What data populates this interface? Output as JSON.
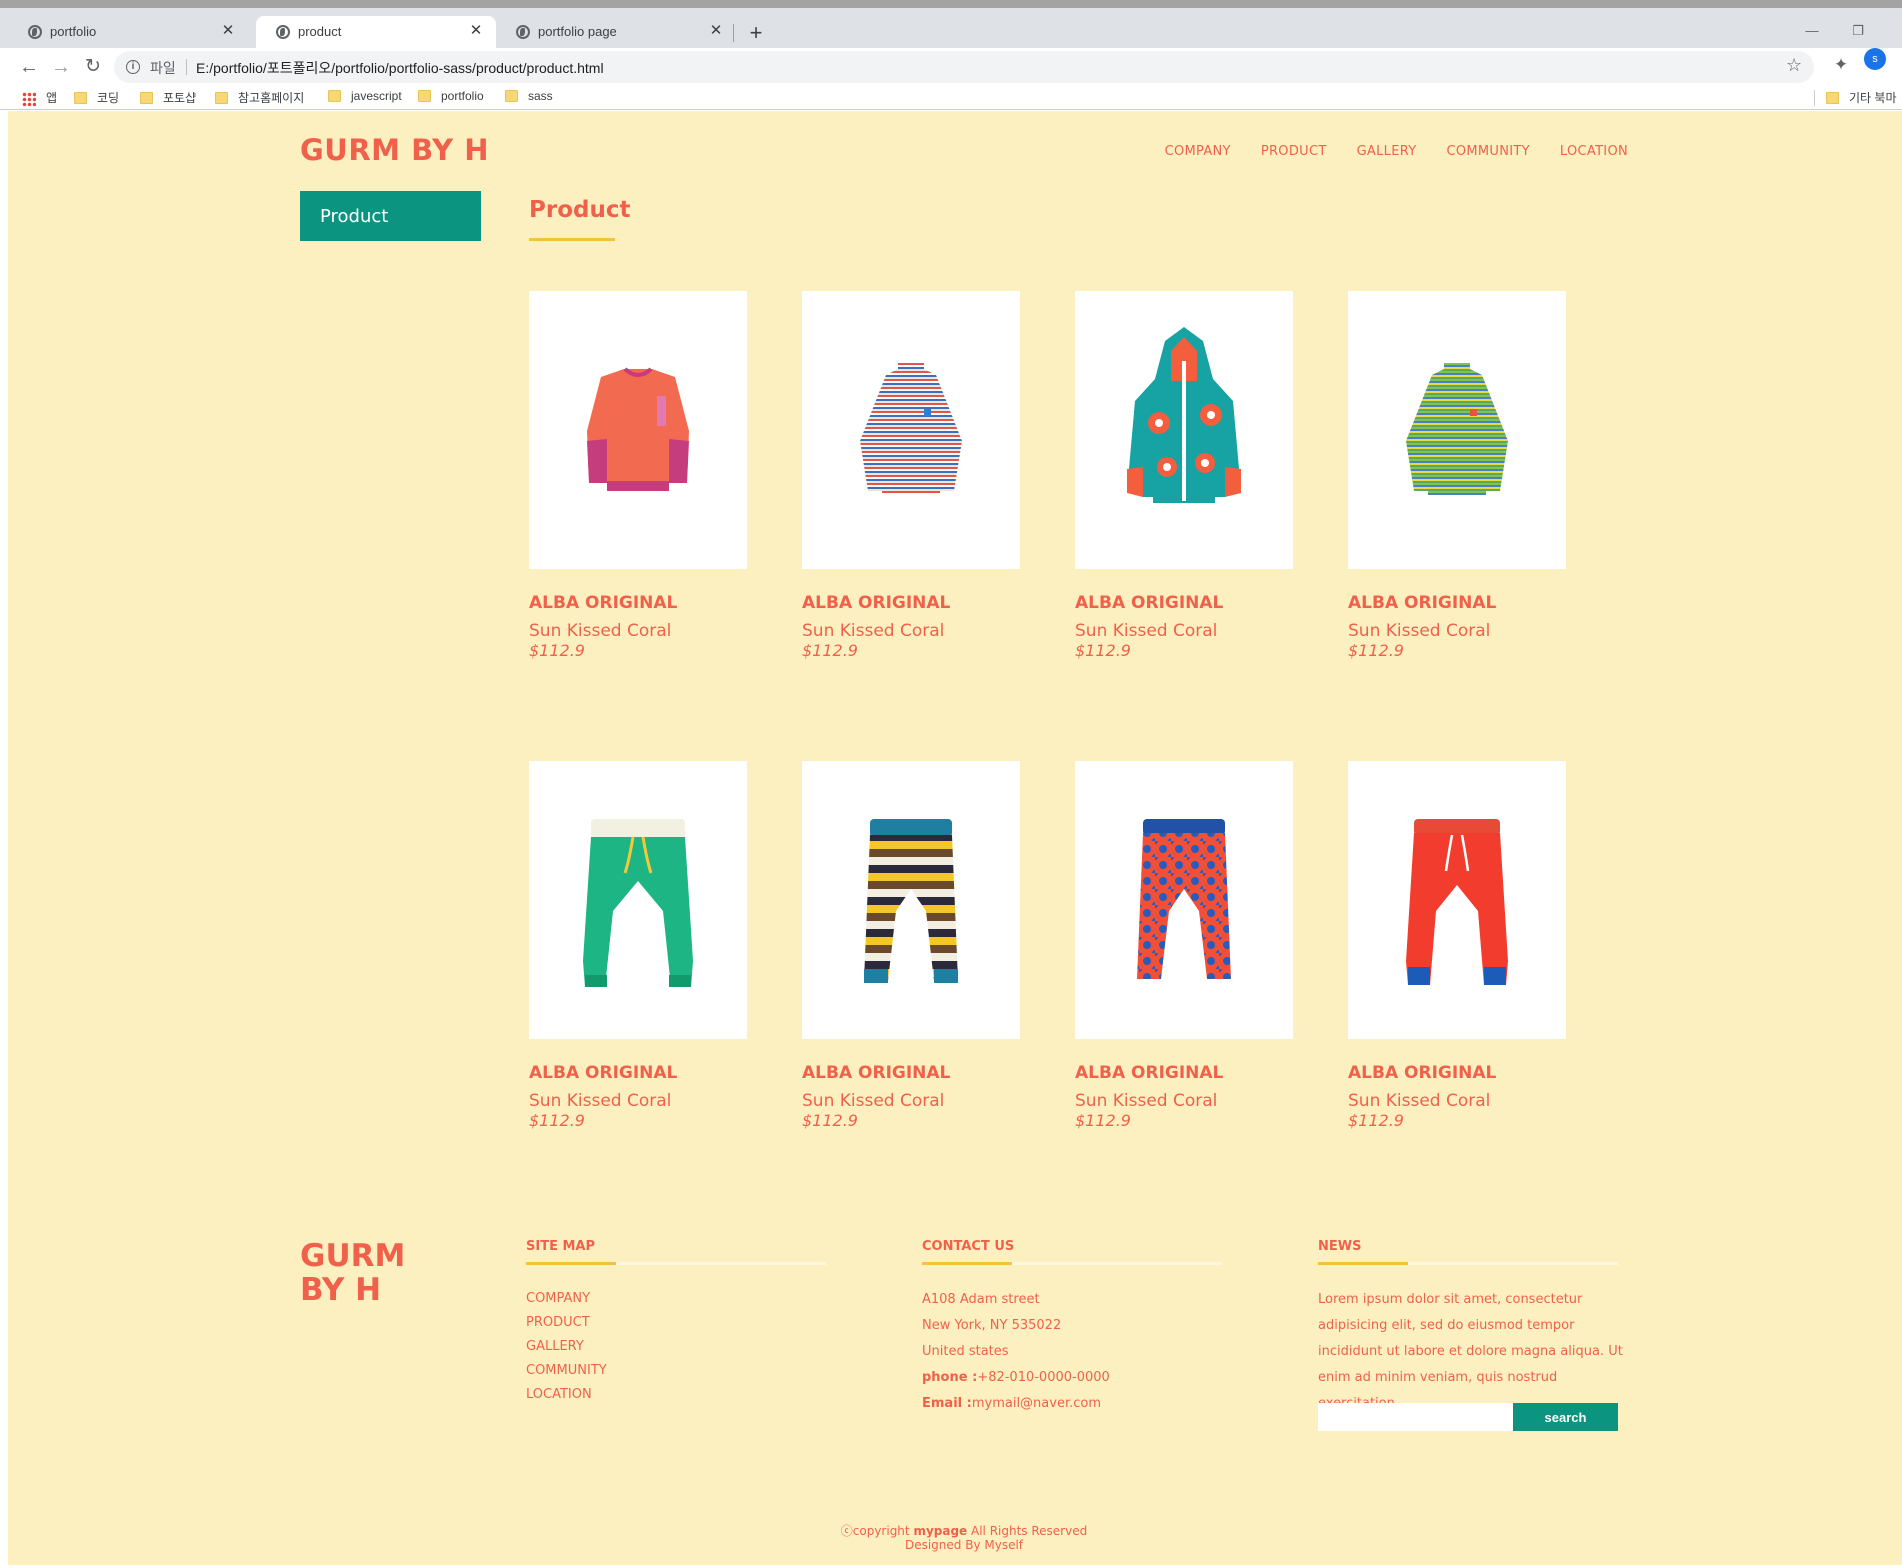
{
  "browser": {
    "tabs": [
      {
        "title": "portfolio",
        "active": false
      },
      {
        "title": "product",
        "active": true
      },
      {
        "title": "portfolio page",
        "active": false
      }
    ],
    "new_tab_label": "+",
    "scheme_label": "파일",
    "url": "E:/portfolio/포트폴리오/portfolio/portfolio-sass/product/product.html",
    "profile_initial": "s",
    "bookmarks": [
      "앱",
      "코딩",
      "포토샵",
      "참고홈페이지",
      "javescript",
      "portfolio",
      "sass"
    ],
    "other_bookmarks": "기타 북마"
  },
  "site": {
    "logo": "GURM BY H",
    "nav": [
      "COMPANY",
      "PRODUCT",
      "GALLERY",
      "COMMUNITY",
      "LOCATION"
    ],
    "side_menu": "Product",
    "page_title": "Product",
    "products": [
      {
        "brand": "ALBA ORIGINAL",
        "name": "Sun Kissed Coral",
        "price": "$112.9",
        "image": "coral-sweatshirt"
      },
      {
        "brand": "ALBA ORIGINAL",
        "name": "Sun Kissed Coral",
        "price": "$112.9",
        "image": "striped-turtleneck"
      },
      {
        "brand": "ALBA ORIGINAL",
        "name": "Sun Kissed Coral",
        "price": "$112.9",
        "image": "floral-hoodie"
      },
      {
        "brand": "ALBA ORIGINAL",
        "name": "Sun Kissed Coral",
        "price": "$112.9",
        "image": "green-striped-turtleneck"
      },
      {
        "brand": "ALBA ORIGINAL",
        "name": "Sun Kissed Coral",
        "price": "$112.9",
        "image": "green-pants"
      },
      {
        "brand": "ALBA ORIGINAL",
        "name": "Sun Kissed Coral",
        "price": "$112.9",
        "image": "striped-pants"
      },
      {
        "brand": "ALBA ORIGINAL",
        "name": "Sun Kissed Coral",
        "price": "$112.9",
        "image": "patterned-pants"
      },
      {
        "brand": "ALBA ORIGINAL",
        "name": "Sun Kissed Coral",
        "price": "$112.9",
        "image": "red-pants"
      }
    ],
    "footer": {
      "logo_line1": "GURM",
      "logo_line2": "BY H",
      "sitemap_title": "SITE MAP",
      "sitemap_links": [
        "COMPANY",
        "PRODUCT",
        "GALLERY",
        "COMMUNITY",
        "LOCATION"
      ],
      "contact_title": "CONTACT US",
      "address1": "A108 Adam street",
      "address2": "New York, NY 535022",
      "address3": "United states",
      "phone_label": "phone :",
      "phone": "+82-010-0000-0000",
      "email_label": "Email :",
      "email": "mymail@naver.com",
      "news_title": "NEWS",
      "news_text": "Lorem ipsum dolor sit amet, consectetur adipisicing elit, sed do eiusmod tempor incididunt ut labore et dolore magna aliqua. Ut enim ad minim veniam, quis nostrud exercitation",
      "search_button": "search",
      "copyright_prefix": "ⓒcopyright ",
      "copyright_brand": "mypage",
      "copyright_suffix": " All Rights Reserved",
      "designed_by": "Designed By Myself"
    }
  },
  "colors": {
    "page_bg": "#fdf0c0",
    "accent": "#f0614b",
    "teal": "#0b9581",
    "underline": "#f5c33b"
  }
}
